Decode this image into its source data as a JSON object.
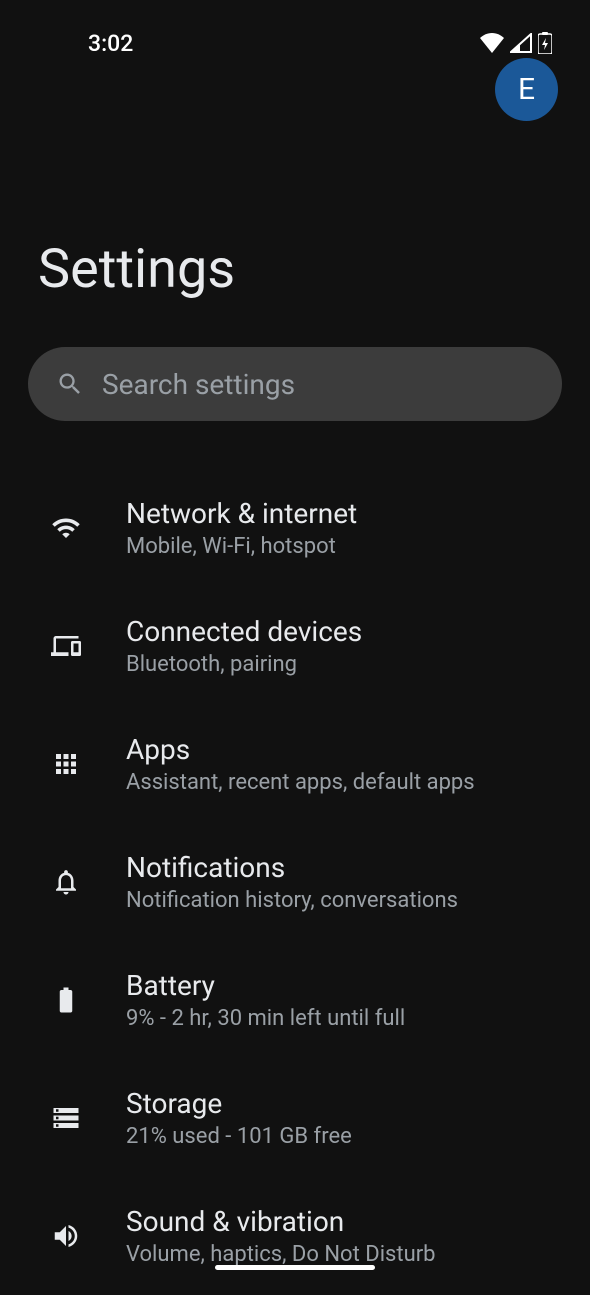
{
  "status": {
    "time": "3:02"
  },
  "header": {
    "avatar_letter": "E",
    "title": "Settings"
  },
  "search": {
    "placeholder": "Search settings"
  },
  "settings": [
    {
      "id": "network",
      "title": "Network & internet",
      "subtitle": "Mobile, Wi-Fi, hotspot"
    },
    {
      "id": "devices",
      "title": "Connected devices",
      "subtitle": "Bluetooth, pairing"
    },
    {
      "id": "apps",
      "title": "Apps",
      "subtitle": "Assistant, recent apps, default apps"
    },
    {
      "id": "notifications",
      "title": "Notifications",
      "subtitle": "Notification history, conversations"
    },
    {
      "id": "battery",
      "title": "Battery",
      "subtitle": "9% - 2 hr, 30 min left until full"
    },
    {
      "id": "storage",
      "title": "Storage",
      "subtitle": "21% used - 101 GB free"
    },
    {
      "id": "sound",
      "title": "Sound & vibration",
      "subtitle": "Volume, haptics, Do Not Disturb"
    }
  ]
}
